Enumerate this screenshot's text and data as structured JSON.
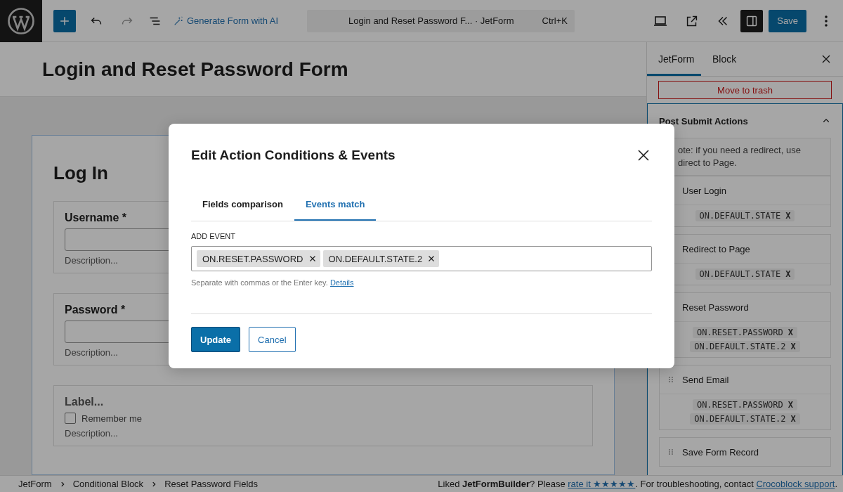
{
  "topbar": {
    "generate_ai": "Generate Form with AI",
    "command": {
      "title": "Login and Reset Password F...",
      "suffix": "· JetForm",
      "shortcut": "Ctrl+K"
    },
    "sidebar_toggle": {
      "on": true
    },
    "save": "Save"
  },
  "editor": {
    "title": "Login and Reset Password Form",
    "form": {
      "heading": "Log In",
      "fields": [
        {
          "kind": "text",
          "label": "Username *",
          "description": "Description..."
        },
        {
          "kind": "text",
          "label": "Password *",
          "description": "Description..."
        },
        {
          "kind": "checkbox",
          "label": "Label...",
          "option": "Remember me",
          "checked": false,
          "description": "Description..."
        }
      ]
    }
  },
  "sidebar": {
    "tabs": [
      {
        "label": "JetForm",
        "selected": true
      },
      {
        "label": "Block",
        "selected": false
      }
    ],
    "trash_button": "Move to trash",
    "panel": {
      "title": "Post Submit Actions",
      "expanded": true,
      "note_lines": [
        "ote: if you need a redirect, use",
        "direct to Page."
      ],
      "actions": [
        {
          "name": "User Login",
          "draggable": false,
          "events": [
            {
              "label": "ON.DEFAULT.STATE",
              "remove": "X"
            }
          ]
        },
        {
          "name": "Redirect to Page",
          "draggable": false,
          "events": [
            {
              "label": "ON.DEFAULT.STATE",
              "remove": "X"
            }
          ]
        },
        {
          "name": "Reset Password",
          "draggable": false,
          "events": [
            {
              "label": "ON.RESET.PASSWORD",
              "remove": "X"
            },
            {
              "label": "ON.DEFAULT.STATE.2",
              "remove": "X"
            }
          ]
        },
        {
          "name": "Send Email",
          "draggable": true,
          "events": [
            {
              "label": "ON.RESET.PASSWORD",
              "remove": "X"
            },
            {
              "label": "ON.DEFAULT.STATE.2",
              "remove": "X"
            }
          ]
        },
        {
          "name": "Save Form Record",
          "draggable": true
        }
      ]
    }
  },
  "modal": {
    "title": "Edit Action Conditions & Events",
    "tabs": [
      {
        "label": "Fields comparison",
        "selected": false
      },
      {
        "label": "Events match",
        "selected": true
      }
    ],
    "field_label": "ADD EVENT",
    "tokens": [
      "ON.RESET.PASSWORD",
      "ON.DEFAULT.STATE.2"
    ],
    "help": "Separate with commas or the Enter key.",
    "help_link": "Details",
    "buttons": [
      {
        "label": "Update",
        "kind": "primary"
      },
      {
        "label": "Cancel",
        "kind": "secondary"
      }
    ]
  },
  "footer": {
    "breadcrumbs": [
      "JetForm",
      "Conditional Block",
      "Reset Password Fields"
    ],
    "notice": {
      "before": "Liked **JetFormBuilder**? Please ",
      "link": "rate it ★★★★★",
      "middle": ". For troubleshooting, contact ",
      "link2": "Crocoblock support",
      "after": "."
    }
  }
}
